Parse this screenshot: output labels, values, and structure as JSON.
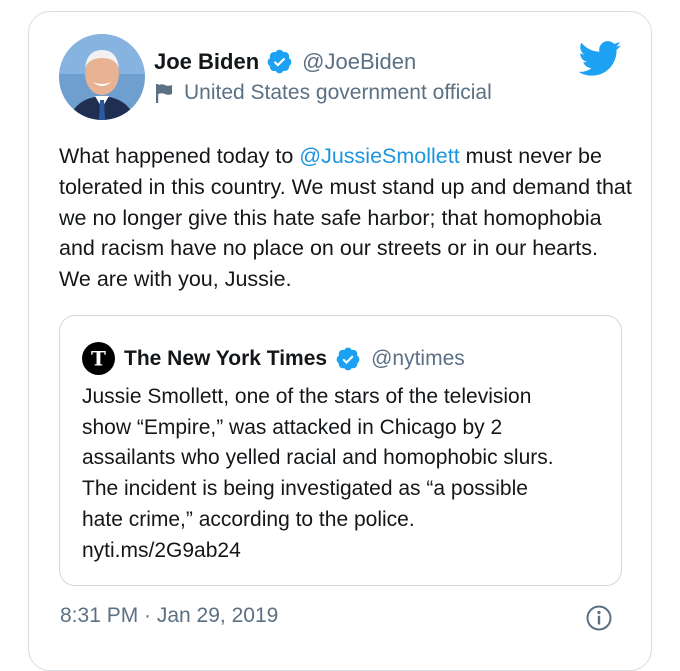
{
  "author": {
    "name": "Joe Biden",
    "handle": "@JoeBiden",
    "label": "United States government official"
  },
  "tweet": {
    "text_before": "What happened today to ",
    "mention": "@JussieSmollett",
    "text_after": " must never be tolerated in this country. We must stand up and demand that we no longer give this hate safe harbor; that homophobia and racism have no place on our streets or in our hearts. We are with you, Jussie."
  },
  "quote": {
    "name": "The New York Times",
    "handle": "@nytimes",
    "lines": [
      "Jussie Smollett, one of the stars of the television",
      "show “Empire,” was attacked in Chicago by 2",
      "assailants who yelled racial and homophobic slurs.",
      "The incident is being investigated as “a possible",
      "hate crime,” according to the police.",
      "nyti.ms/2G9ab24"
    ]
  },
  "timestamp": "8:31 PM · Jan 29, 2019",
  "icons": {
    "brand": "twitter-bird-icon",
    "verified": "verified-badge-icon",
    "label": "flag-icon",
    "info": "info-icon"
  },
  "colors": {
    "accent": "#1da1f2",
    "link": "#1b95e0",
    "muted": "#5b7083",
    "border": "#d8dde1"
  }
}
